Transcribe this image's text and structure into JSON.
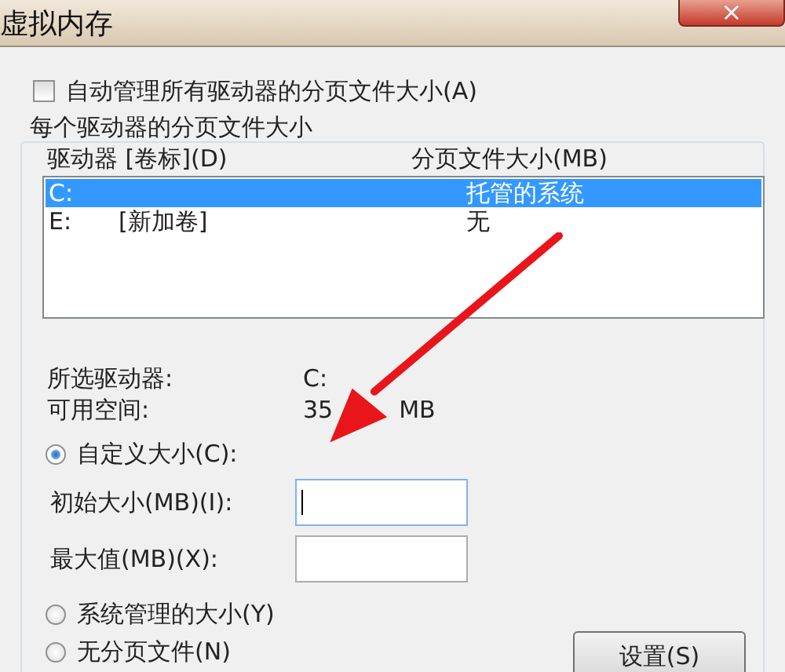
{
  "window": {
    "title": "虚拟内存",
    "close": "×"
  },
  "auto_manage": {
    "label": "自动管理所有驱动器的分页文件大小(A)",
    "checked": false
  },
  "group": {
    "title": "每个驱动器的分页文件大小",
    "columns": [
      "驱动器 [卷标](D)",
      "分页文件大小(MB)"
    ],
    "rows": [
      {
        "drive": "C:",
        "size": "托管的系统",
        "selected": true
      },
      {
        "drive": "E:",
        "label": "[新加卷]",
        "size": "无",
        "selected": false
      }
    ],
    "selected_drive": {
      "label": "所选驱动器:",
      "value": "C:"
    },
    "free_space": {
      "label": "可用空间:",
      "value": "35",
      "unit": "MB"
    },
    "options": [
      {
        "kind": "radio",
        "label": "自定义大小(C):",
        "selected": true
      },
      {
        "kind": "field",
        "label": "初始大小(MB)(I):",
        "focused": true
      },
      {
        "kind": "field",
        "label": "最大值(MB)(X):",
        "focused": false
      },
      {
        "kind": "radio",
        "label": "系统管理的大小(Y)",
        "selected": false
      },
      {
        "kind": "radio",
        "label": "无分页文件(N)",
        "selected": false
      }
    ],
    "set_button": "设置(S)"
  }
}
